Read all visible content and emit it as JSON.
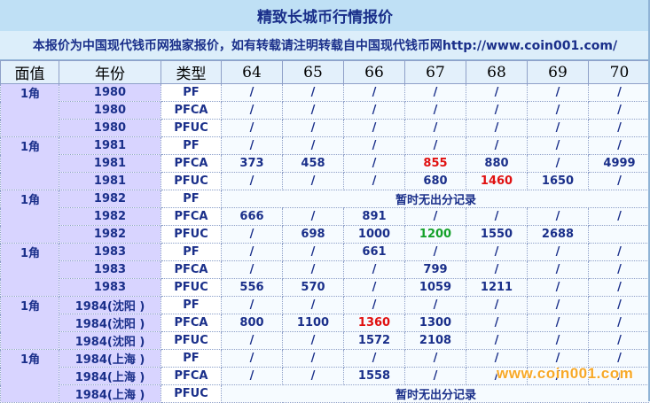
{
  "title": "精致长城币行情报价",
  "notice": "本报价为中国现代钱币网独家报价，如有转载请注明转载自中国现代钱币网http://www.coin001.com/",
  "headers": [
    "面值",
    "年份",
    "类型",
    "64",
    "65",
    "66",
    "67",
    "68",
    "69",
    "70"
  ],
  "no_record_text": "暂时无出分记录",
  "watermark": "www.coin001.com",
  "colors": {
    "highlight_red": "#e01010",
    "highlight_green": "#15a12a",
    "text": "#1a2f8a"
  },
  "groups": [
    {
      "denomination": "1角",
      "rows": [
        {
          "year": "1980",
          "type": "PF",
          "prices": [
            "/",
            "/",
            "/",
            "/",
            "/",
            "/",
            "/"
          ]
        },
        {
          "year": "1980",
          "type": "PFCA",
          "prices": [
            "/",
            "/",
            "/",
            "/",
            "/",
            "/",
            "/"
          ]
        },
        {
          "year": "1980",
          "type": "PFUC",
          "prices": [
            "/",
            "/",
            "/",
            "/",
            "/",
            "/",
            "/"
          ]
        }
      ]
    },
    {
      "denomination": "1角",
      "rows": [
        {
          "year": "1981",
          "type": "PF",
          "prices": [
            "/",
            "/",
            "/",
            "/",
            "/",
            "/",
            "/"
          ]
        },
        {
          "year": "1981",
          "type": "PFCA",
          "prices": [
            "373",
            "458",
            "/",
            "855",
            "880",
            "/",
            "4999"
          ],
          "highlight": {
            "3": "red"
          }
        },
        {
          "year": "1981",
          "type": "PFUC",
          "prices": [
            "/",
            "/",
            "/",
            "680",
            "1460",
            "1650",
            "/"
          ],
          "highlight": {
            "4": "red"
          }
        }
      ]
    },
    {
      "denomination": "1角",
      "rows": [
        {
          "year": "1982",
          "type": "PF",
          "no_record": true
        },
        {
          "year": "1982",
          "type": "PFCA",
          "prices": [
            "666",
            "/",
            "891",
            "/",
            "/",
            "/",
            "/"
          ]
        },
        {
          "year": "1982",
          "type": "PFUC",
          "prices": [
            "/",
            "698",
            "1000",
            "1200",
            "1550",
            "2688",
            ""
          ],
          "highlight": {
            "3": "green"
          }
        }
      ]
    },
    {
      "denomination": "1角",
      "rows": [
        {
          "year": "1983",
          "type": "PF",
          "prices": [
            "/",
            "/",
            "661",
            "/",
            "/",
            "/",
            "/"
          ]
        },
        {
          "year": "1983",
          "type": "PFCA",
          "prices": [
            "/",
            "/",
            "/",
            "799",
            "/",
            "/",
            "/"
          ]
        },
        {
          "year": "1983",
          "type": "PFUC",
          "prices": [
            "556",
            "570",
            "/",
            "1059",
            "1211",
            "/",
            "/"
          ]
        }
      ]
    },
    {
      "denomination": "1角",
      "rows": [
        {
          "year": "1984(沈阳 )",
          "type": "PF",
          "prices": [
            "/",
            "/",
            "/",
            "/",
            "/",
            "/",
            "/"
          ]
        },
        {
          "year": "1984(沈阳 )",
          "type": "PFCA",
          "prices": [
            "800",
            "1100",
            "1360",
            "1300",
            "/",
            "/",
            "/"
          ],
          "highlight": {
            "2": "red"
          }
        },
        {
          "year": "1984(沈阳 )",
          "type": "PFUC",
          "prices": [
            "/",
            "/",
            "1572",
            "2108",
            "/",
            "/",
            "/"
          ]
        }
      ]
    },
    {
      "denomination": "1角",
      "rows": [
        {
          "year": "1984(上海 )",
          "type": "PF",
          "prices": [
            "/",
            "/",
            "/",
            "/",
            "/",
            "/",
            "/"
          ]
        },
        {
          "year": "1984(上海 )",
          "type": "PFCA",
          "prices": [
            "/",
            "/",
            "1558",
            "/",
            "/",
            "/",
            "/"
          ]
        },
        {
          "year": "1984(上海 )",
          "type": "PFUC",
          "no_record": true
        }
      ]
    }
  ]
}
